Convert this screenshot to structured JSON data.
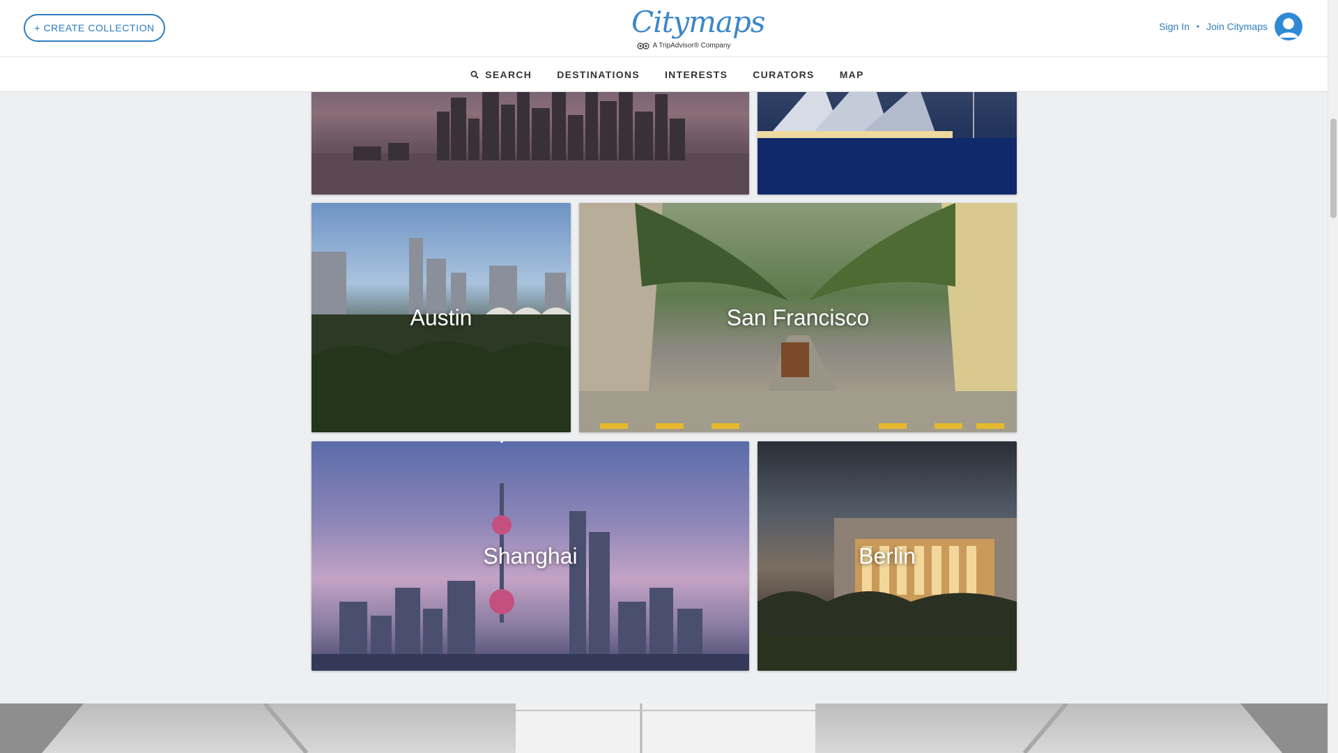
{
  "header": {
    "create_label": "+ CREATE COLLECTION",
    "logo_text": "Citymaps",
    "tagline": "A TripAdvisor® Company",
    "sign_in": "Sign In",
    "separator": "•",
    "join": "Join Citymaps"
  },
  "nav": {
    "search": "SEARCH",
    "destinations": "DESTINATIONS",
    "interests": "INTERESTS",
    "curators": "CURATORS",
    "map": "MAP"
  },
  "tiles": {
    "austin": "Austin",
    "san_francisco": "San Francisco",
    "shanghai": "Shanghai",
    "berlin": "Berlin"
  },
  "colors": {
    "accent": "#2b7cc1",
    "background": "#eeeff1"
  },
  "icons": {
    "search": "search-icon",
    "avatar": "user-avatar-icon",
    "owl": "tripadvisor-owl-icon"
  }
}
